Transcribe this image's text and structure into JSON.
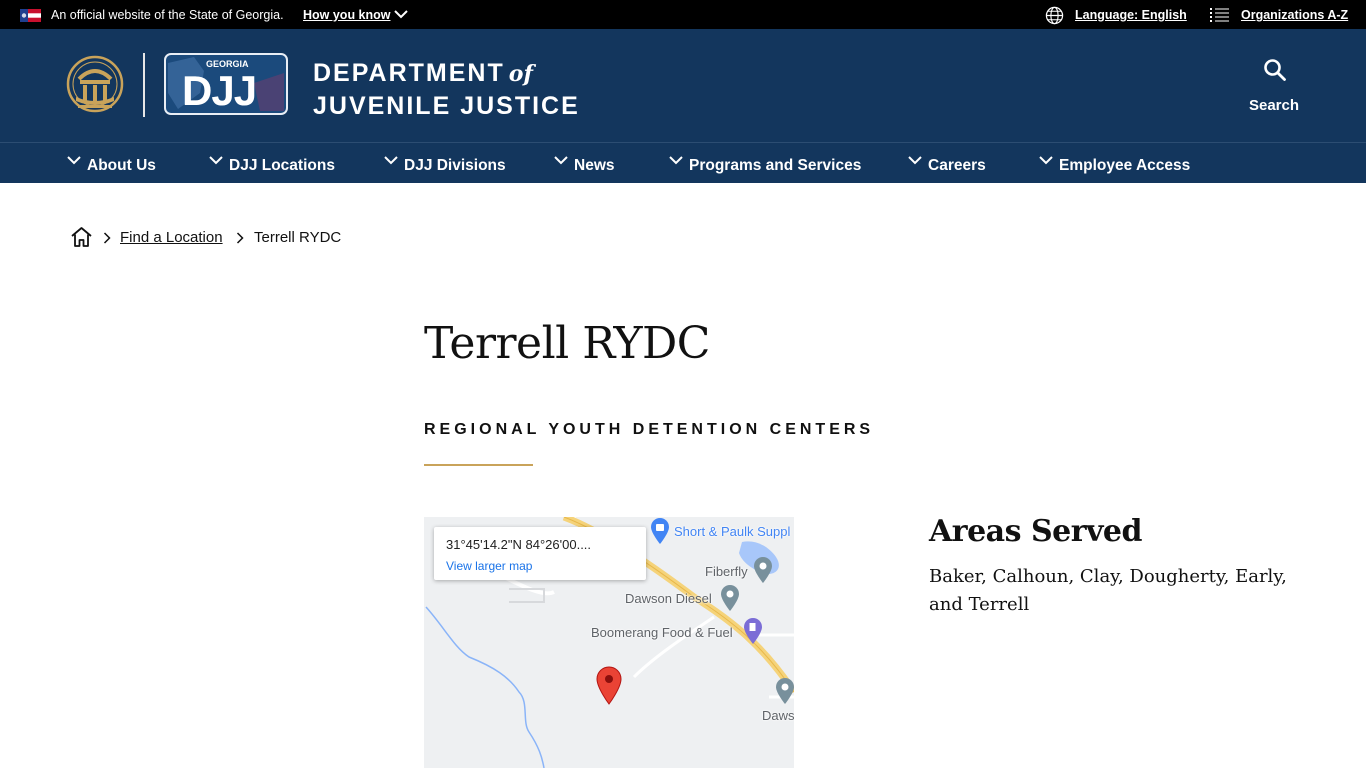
{
  "topbar": {
    "official_text": "An official website of the State of Georgia.",
    "how_you_know": "How you know",
    "language": "Language: English",
    "organizations": "Organizations A-Z"
  },
  "header": {
    "logo_text": "GEORGIA DJJ",
    "title_line1": "DEPARTMENT",
    "title_of": "of",
    "title_line2": "JUVENILE JUSTICE",
    "search_label": "Search"
  },
  "nav": {
    "items": [
      {
        "label": "About Us"
      },
      {
        "label": "DJJ Locations"
      },
      {
        "label": "DJJ Divisions"
      },
      {
        "label": "News"
      },
      {
        "label": "Programs and Services"
      },
      {
        "label": "Careers"
      },
      {
        "label": "Employee Access"
      }
    ]
  },
  "breadcrumb": {
    "parent": "Find a Location",
    "current": "Terrell RYDC"
  },
  "main": {
    "title": "Terrell RYDC",
    "category": "REGIONAL YOUTH DETENTION CENTERS"
  },
  "map": {
    "coords": "31°45'14.2\"N 84°26'00....",
    "view_larger": "View larger map",
    "places": [
      "Short & Paulk Suppl",
      "Fiberfly",
      "Dawson Diesel",
      "Boomerang Food & Fuel",
      "Daws"
    ]
  },
  "areas": {
    "title": "Areas Served",
    "text": "Baker, Calhoun, Clay, Dougherty, Early, and Terrell"
  },
  "colors": {
    "header_bg": "#13365d",
    "gold": "#c9a35a",
    "topbar_bg": "#000000",
    "map_link": "#1a73e8"
  }
}
